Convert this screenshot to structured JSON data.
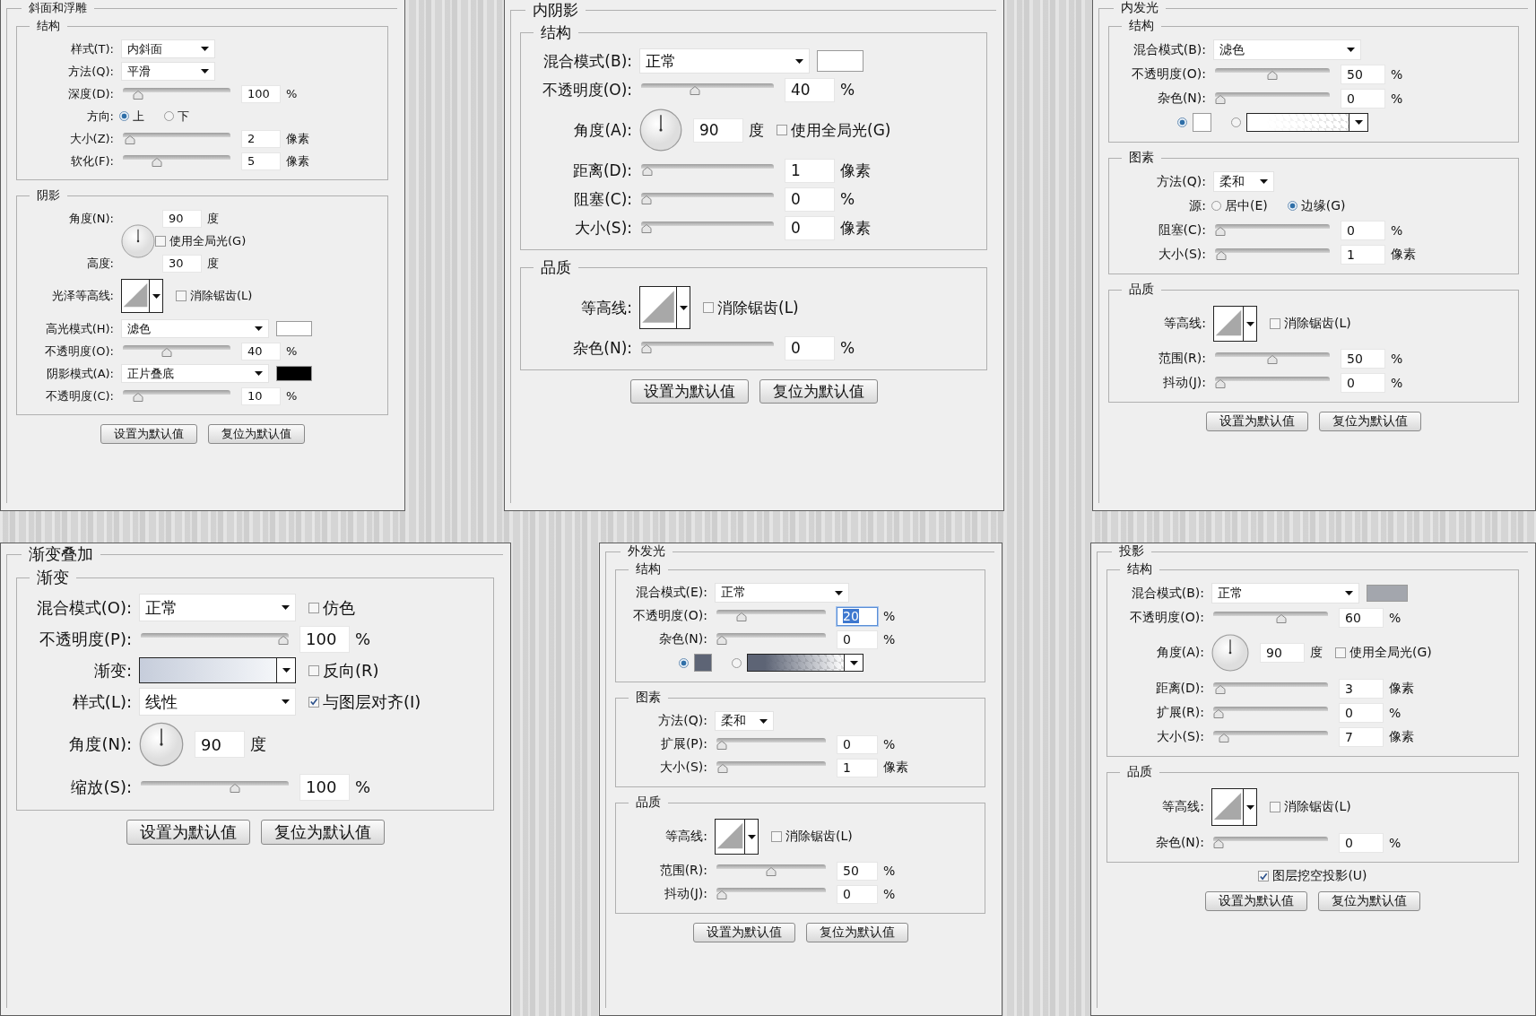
{
  "panels": [
    {
      "title": "斜面和浮雕",
      "groups": [
        {
          "title": "结构",
          "rows": [
            {
              "kind": "short-select",
              "label": "样式(T):",
              "value": "内斜面"
            },
            {
              "kind": "short-select",
              "label": "方法(Q):",
              "value": "平滑"
            },
            {
              "kind": "slider",
              "label": "深度(D):",
              "level": 0.1,
              "value": "100",
              "unit": "%"
            },
            {
              "kind": "radio",
              "label": "方向:",
              "options": [
                {
                  "label": "上",
                  "selected": true
                },
                {
                  "label": "下",
                  "selected": false
                }
              ]
            },
            {
              "kind": "slider",
              "label": "大小(Z):",
              "level": 0.02,
              "value": "2",
              "unit": "像素"
            },
            {
              "kind": "slider",
              "label": "软化(F):",
              "level": 0.3,
              "value": "5",
              "unit": "像素"
            }
          ]
        },
        {
          "title": "阴影",
          "rows": [
            {
              "kind": "angle-altitude",
              "label": "角度(N):",
              "value": "90",
              "unit": "度",
              "checkbox": {
                "label": "使用全局光(G)",
                "checked": false
              },
              "altitude_label": "高度:",
              "altitude_value": "30",
              "altitude_unit": "度"
            },
            {
              "kind": "contour",
              "label": "光泽等高线:",
              "checkbox": {
                "label": "消除锯齿(L)",
                "checked": false
              }
            },
            {
              "kind": "select",
              "label": "高光模式(H):",
              "value": "滤色",
              "color": "#ffffff"
            },
            {
              "kind": "slider",
              "label": "不透明度(O):",
              "level": 0.4,
              "value": "40",
              "unit": "%"
            },
            {
              "kind": "select",
              "label": "阴影模式(A):",
              "value": "正片叠底",
              "color": "#000000"
            },
            {
              "kind": "slider",
              "label": "不透明度(C):",
              "level": 0.1,
              "value": "10",
              "unit": "%"
            }
          ]
        }
      ],
      "buttons": [
        "设置为默认值",
        "复位为默认值"
      ]
    },
    {
      "title": "内阴影",
      "groups": [
        {
          "title": "结构",
          "rows": [
            {
              "kind": "select",
              "label": "混合模式(B):",
              "value": "正常",
              "color": "#ffffff"
            },
            {
              "kind": "slider",
              "label": "不透明度(O):",
              "level": 0.4,
              "value": "40",
              "unit": "%"
            },
            {
              "kind": "angle",
              "label": "角度(A):",
              "value": "90",
              "unit": "度",
              "checkbox": {
                "label": "使用全局光(G)",
                "checked": false
              }
            },
            {
              "kind": "slider",
              "label": "距离(D):",
              "level": 0.01,
              "value": "1",
              "unit": "像素"
            },
            {
              "kind": "slider",
              "label": "阻塞(C):",
              "level": 0,
              "value": "0",
              "unit": "%"
            },
            {
              "kind": "slider",
              "label": "大小(S):",
              "level": 0,
              "value": "0",
              "unit": "像素"
            }
          ]
        },
        {
          "title": "品质",
          "rows": [
            {
              "kind": "contour",
              "label": "等高线:",
              "checkbox": {
                "label": "消除锯齿(L)",
                "checked": false
              }
            },
            {
              "kind": "slider",
              "label": "杂色(N):",
              "level": 0,
              "value": "0",
              "unit": "%"
            }
          ]
        }
      ],
      "buttons": [
        "设置为默认值",
        "复位为默认值"
      ]
    },
    {
      "title": "内发光",
      "groups": [
        {
          "title": "结构",
          "rows": [
            {
              "kind": "select",
              "label": "混合模式(B):",
              "value": "滤色"
            },
            {
              "kind": "slider",
              "label": "不透明度(O):",
              "level": 0.5,
              "value": "50",
              "unit": "%"
            },
            {
              "kind": "slider",
              "label": "杂色(N):",
              "level": 0,
              "value": "0",
              "unit": "%"
            },
            {
              "kind": "fill",
              "options": [
                {
                  "kind": "swatch",
                  "selected": true,
                  "color": "#ffffff"
                },
                {
                  "kind": "gradient",
                  "selected": false,
                  "color": "#ffffff"
                }
              ]
            }
          ]
        },
        {
          "title": "图素",
          "rows": [
            {
              "kind": "short-select",
              "label": "方法(Q):",
              "value": "柔和"
            },
            {
              "kind": "radio",
              "label": "源:",
              "options": [
                {
                  "label": "居中(E)",
                  "selected": false
                },
                {
                  "label": "边缘(G)",
                  "selected": true
                }
              ]
            },
            {
              "kind": "slider",
              "label": "阻塞(C):",
              "level": 0,
              "value": "0",
              "unit": "%"
            },
            {
              "kind": "slider",
              "label": "大小(S):",
              "level": 0.01,
              "value": "1",
              "unit": "像素"
            }
          ]
        },
        {
          "title": "品质",
          "rows": [
            {
              "kind": "contour",
              "label": "等高线:",
              "checkbox": {
                "label": "消除锯齿(L)",
                "checked": false
              }
            },
            {
              "kind": "slider",
              "label": "范围(R):",
              "level": 0.5,
              "value": "50",
              "unit": "%"
            },
            {
              "kind": "slider",
              "label": "抖动(J):",
              "level": 0,
              "value": "0",
              "unit": "%"
            }
          ]
        }
      ],
      "buttons": [
        "设置为默认值",
        "复位为默认值"
      ]
    },
    {
      "title": "渐变叠加",
      "groups": [
        {
          "title": "渐变",
          "rows": [
            {
              "kind": "select",
              "label": "混合模式(O):",
              "value": "正常",
              "checkbox": {
                "label": "仿色",
                "checked": false
              }
            },
            {
              "kind": "slider",
              "label": "不透明度(P):",
              "level": 1,
              "value": "100",
              "unit": "%"
            },
            {
              "kind": "gradient",
              "label": "渐变:",
              "color": "#c6cddb",
              "checkbox": {
                "label": "反向(R)",
                "checked": false
              }
            },
            {
              "kind": "select",
              "label": "样式(L):",
              "value": "线性",
              "checkbox": {
                "label": "与图层对齐(I)",
                "checked": true
              }
            },
            {
              "kind": "angle",
              "label": "角度(N):",
              "value": "90",
              "unit": "度"
            },
            {
              "kind": "slider",
              "label": "缩放(S):",
              "level": 0.65,
              "value": "100",
              "unit": "%"
            }
          ]
        }
      ],
      "buttons": [
        "设置为默认值",
        "复位为默认值"
      ]
    },
    {
      "title": "外发光",
      "groups": [
        {
          "title": "结构",
          "rows": [
            {
              "kind": "select",
              "label": "混合模式(E):",
              "value": "正常"
            },
            {
              "kind": "slider",
              "label": "不透明度(O):",
              "level": 0.2,
              "value": "20",
              "unit": "%",
              "highlighted": true
            },
            {
              "kind": "slider",
              "label": "杂色(N):",
              "level": 0,
              "value": "0",
              "unit": "%"
            },
            {
              "kind": "fill",
              "options": [
                {
                  "kind": "swatch",
                  "selected": true,
                  "color": "#5d6475"
                },
                {
                  "kind": "gradient",
                  "selected": false,
                  "color": "#5d6475"
                }
              ]
            }
          ]
        },
        {
          "title": "图素",
          "rows": [
            {
              "kind": "short-select",
              "label": "方法(Q):",
              "value": "柔和"
            },
            {
              "kind": "slider",
              "label": "扩展(P):",
              "level": 0,
              "value": "0",
              "unit": "%"
            },
            {
              "kind": "slider",
              "label": "大小(S):",
              "level": 0.01,
              "value": "1",
              "unit": "像素"
            }
          ]
        },
        {
          "title": "品质",
          "rows": [
            {
              "kind": "contour",
              "label": "等高线:",
              "checkbox": {
                "label": "消除锯齿(L)",
                "checked": false
              }
            },
            {
              "kind": "slider",
              "label": "范围(R):",
              "level": 0.5,
              "value": "50",
              "unit": "%"
            },
            {
              "kind": "slider",
              "label": "抖动(J):",
              "level": 0,
              "value": "0",
              "unit": "%"
            }
          ]
        }
      ],
      "buttons": [
        "设置为默认值",
        "复位为默认值"
      ]
    },
    {
      "title": "投影",
      "groups": [
        {
          "title": "结构",
          "rows": [
            {
              "kind": "select",
              "label": "混合模式(B):",
              "value": "正常",
              "color": "#a3a6ad"
            },
            {
              "kind": "slider",
              "label": "不透明度(O):",
              "level": 0.6,
              "value": "60",
              "unit": "%"
            },
            {
              "kind": "angle",
              "label": "角度(A):",
              "value": "90",
              "unit": "度",
              "checkbox": {
                "label": "使用全局光(G)",
                "checked": false
              }
            },
            {
              "kind": "slider",
              "label": "距离(D):",
              "level": 0.02,
              "value": "3",
              "unit": "像素"
            },
            {
              "kind": "slider",
              "label": "扩展(R):",
              "level": 0,
              "value": "0",
              "unit": "%"
            },
            {
              "kind": "slider",
              "label": "大小(S):",
              "level": 0.05,
              "value": "7",
              "unit": "像素"
            }
          ]
        },
        {
          "title": "品质",
          "rows": [
            {
              "kind": "contour",
              "label": "等高线:",
              "checkbox": {
                "label": "消除锯齿(L)",
                "checked": false
              }
            },
            {
              "kind": "slider",
              "label": "杂色(N):",
              "level": 0,
              "value": "0",
              "unit": "%"
            }
          ]
        }
      ],
      "footer_checkbox": {
        "label": "图层挖空投影(U)",
        "checked": true
      },
      "buttons": [
        "设置为默认值",
        "复位为默认值"
      ]
    }
  ]
}
